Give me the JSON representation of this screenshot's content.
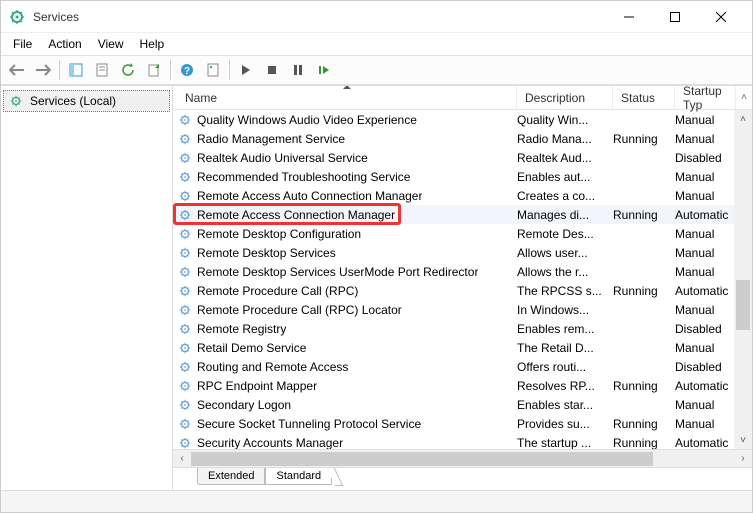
{
  "window": {
    "title": "Services"
  },
  "menubar": {
    "file": "File",
    "action": "Action",
    "view": "View",
    "help": "Help"
  },
  "left": {
    "root": "Services (Local)"
  },
  "columns": {
    "name": "Name",
    "description": "Description",
    "status": "Status",
    "startup": "Startup Typ"
  },
  "tabs": {
    "extended": "Extended",
    "standard": "Standard"
  },
  "services": [
    {
      "name": "Quality Windows Audio Video Experience",
      "desc": "Quality Win...",
      "status": "",
      "startup": "Manual"
    },
    {
      "name": "Radio Management Service",
      "desc": "Radio Mana...",
      "status": "Running",
      "startup": "Manual"
    },
    {
      "name": "Realtek Audio Universal Service",
      "desc": "Realtek Aud...",
      "status": "",
      "startup": "Disabled"
    },
    {
      "name": "Recommended Troubleshooting Service",
      "desc": "Enables aut...",
      "status": "",
      "startup": "Manual"
    },
    {
      "name": "Remote Access Auto Connection Manager",
      "desc": "Creates a co...",
      "status": "",
      "startup": "Manual"
    },
    {
      "name": "Remote Access Connection Manager",
      "desc": "Manages di...",
      "status": "Running",
      "startup": "Automatic"
    },
    {
      "name": "Remote Desktop Configuration",
      "desc": "Remote Des...",
      "status": "",
      "startup": "Manual"
    },
    {
      "name": "Remote Desktop Services",
      "desc": "Allows user...",
      "status": "",
      "startup": "Manual"
    },
    {
      "name": "Remote Desktop Services UserMode Port Redirector",
      "desc": "Allows the r...",
      "status": "",
      "startup": "Manual"
    },
    {
      "name": "Remote Procedure Call (RPC)",
      "desc": "The RPCSS s...",
      "status": "Running",
      "startup": "Automatic"
    },
    {
      "name": "Remote Procedure Call (RPC) Locator",
      "desc": "In Windows...",
      "status": "",
      "startup": "Manual"
    },
    {
      "name": "Remote Registry",
      "desc": "Enables rem...",
      "status": "",
      "startup": "Disabled"
    },
    {
      "name": "Retail Demo Service",
      "desc": "The Retail D...",
      "status": "",
      "startup": "Manual"
    },
    {
      "name": "Routing and Remote Access",
      "desc": "Offers routi...",
      "status": "",
      "startup": "Disabled"
    },
    {
      "name": "RPC Endpoint Mapper",
      "desc": "Resolves RP...",
      "status": "Running",
      "startup": "Automatic"
    },
    {
      "name": "Secondary Logon",
      "desc": "Enables star...",
      "status": "",
      "startup": "Manual"
    },
    {
      "name": "Secure Socket Tunneling Protocol Service",
      "desc": "Provides su...",
      "status": "Running",
      "startup": "Manual"
    },
    {
      "name": "Security Accounts Manager",
      "desc": "The startup ...",
      "status": "Running",
      "startup": "Automatic"
    }
  ],
  "highlighted_index": 5
}
